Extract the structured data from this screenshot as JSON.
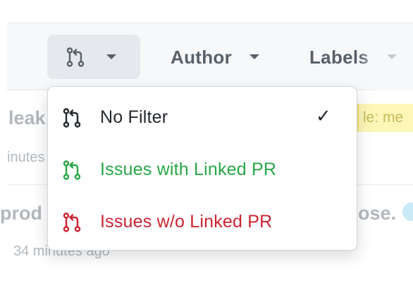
{
  "filter_bar": {
    "linked_pr_icon": "git-pull-request-icon",
    "author_label": "Author",
    "labels_label": "Labels"
  },
  "rows": [
    {
      "title_fragment": "leak",
      "meta_fragment": "inutes",
      "label_chip": "le: me"
    },
    {
      "title_fragment": "prod",
      "title_end_fragment": "ose.",
      "meta_fragment": "34 minutes ago"
    }
  ],
  "dropdown": {
    "items": [
      {
        "label": "No Filter",
        "icon": "git-pull-request-icon",
        "color": "#24292e",
        "selected": true,
        "check": "✓"
      },
      {
        "label": "Issues with Linked PR",
        "icon": "git-pull-request-icon",
        "color": "#28a745",
        "selected": false
      },
      {
        "label": "Issues w/o Linked PR",
        "icon": "git-pull-request-icon",
        "color": "#cb2431",
        "selected": false
      }
    ]
  },
  "colors": {
    "muted_text": "#586069",
    "bar_background": "#f6f8fa",
    "green": "#28a745",
    "red": "#cb2431",
    "dark": "#24292e"
  }
}
